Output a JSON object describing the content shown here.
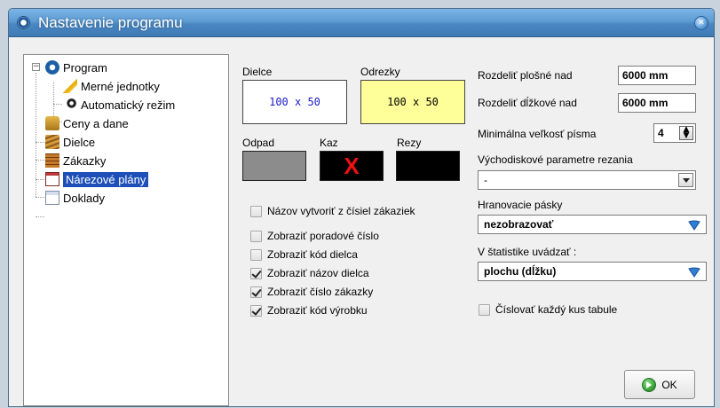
{
  "window": {
    "title": "Nastavenie programu",
    "close_symbol": "✕"
  },
  "tree": {
    "expander": "−",
    "items": [
      {
        "label": "Program",
        "icon": "program-icon"
      },
      {
        "label": "Merné jednotky",
        "icon": "ruler-icon"
      },
      {
        "label": "Automatický režim",
        "icon": "auto-mode-icon"
      },
      {
        "label": "Ceny a dane",
        "icon": "coins-icon"
      },
      {
        "label": "Dielce",
        "icon": "wood-icon"
      },
      {
        "label": "Zákazky",
        "icon": "stack-icon"
      },
      {
        "label": "Nárezové plány",
        "icon": "cutting-plan-icon",
        "selected": true
      },
      {
        "label": "Doklady",
        "icon": "document-icon"
      }
    ]
  },
  "preview": {
    "dielce_label": "Dielce",
    "dielce_text": "100 x 50",
    "dielce_text_color": "#1a1acc",
    "odrezky_label": "Odrezky",
    "odrezky_text": "100 x 50",
    "odrezky_bg": "#ffff99",
    "odpad_label": "Odpad",
    "odpad_color": "#8c8c8c",
    "kaz_label": "Kaz",
    "kaz_mark": "X",
    "kaz_mark_color": "#ee1111",
    "rezy_label": "Rezy",
    "rezy_color": "#000000"
  },
  "options": {
    "name_from_orders": {
      "label": "Názov vytvoriť z čísiel zákaziek",
      "checked": false
    },
    "show_order_number": {
      "label": "Zobraziť poradové číslo",
      "checked": false
    },
    "show_part_code": {
      "label": "Zobraziť kód dielca",
      "checked": false
    },
    "show_part_name": {
      "label": "Zobraziť názov dielca",
      "checked": true
    },
    "show_order_no": {
      "label": "Zobraziť číslo zákazky",
      "checked": true
    },
    "show_product_code": {
      "label": "Zobraziť kód výrobku",
      "checked": true
    }
  },
  "settings": {
    "split_area_label": "Rozdeliť plošné nad",
    "split_area_value": "6000 mm",
    "split_length_label": "Rozdeliť dĺžkové nad",
    "split_length_value": "6000 mm",
    "min_font_label": "Minimálna veľkosť písma",
    "min_font_value": "4",
    "default_params_label": "Východiskové parametre rezania",
    "default_params_value": "-",
    "edge_bands_label": "Hranovacie pásky",
    "edge_bands_value": "nezobrazovať",
    "statistics_label": "V štatistike uvádzať :",
    "statistics_value": "plochu (dĺžku)",
    "number_each_piece": {
      "label": "Číslovať každý kus tabule",
      "checked": false
    }
  },
  "ok_label": "OK"
}
